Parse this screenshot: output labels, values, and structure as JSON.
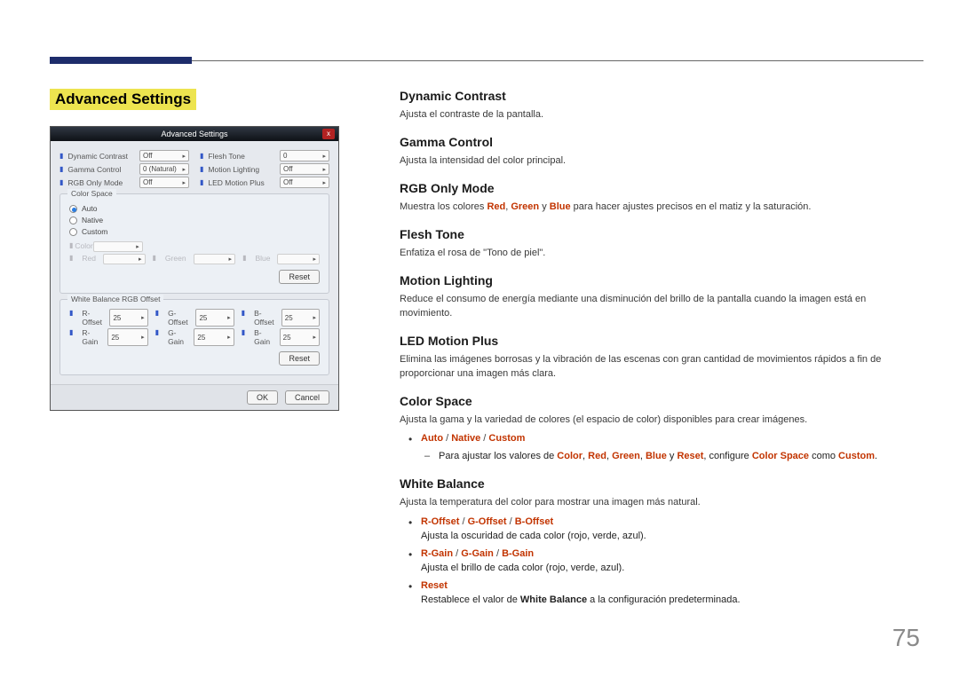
{
  "page_number": "75",
  "heading": "Advanced Settings",
  "dialog": {
    "title": "Advanced Settings",
    "rows_left": [
      {
        "label": "Dynamic Contrast",
        "value": "Off"
      },
      {
        "label": "Gamma Control",
        "value": "0 (Natural)"
      },
      {
        "label": "RGB Only Mode",
        "value": "Off"
      }
    ],
    "rows_right": [
      {
        "label": "Flesh Tone",
        "value": "0"
      },
      {
        "label": "Motion Lighting",
        "value": "Off"
      },
      {
        "label": "LED Motion Plus",
        "value": "Off"
      }
    ],
    "color_space": {
      "legend": "Color Space",
      "radios": [
        {
          "label": "Auto",
          "checked": true
        },
        {
          "label": "Native",
          "checked": false
        },
        {
          "label": "Custom",
          "checked": false
        }
      ],
      "disabled_row": [
        {
          "label": "Color",
          "value": ""
        },
        {
          "label": "Red",
          "value": ""
        },
        {
          "label": "Green",
          "value": ""
        },
        {
          "label": "Blue",
          "value": ""
        }
      ],
      "reset": "Reset"
    },
    "wb": {
      "legend": "White Balance RGB Offset",
      "rows": [
        [
          {
            "label": "R-Offset",
            "value": "25"
          },
          {
            "label": "G-Offset",
            "value": "25"
          },
          {
            "label": "B-Offset",
            "value": "25"
          }
        ],
        [
          {
            "label": "R-Gain",
            "value": "25"
          },
          {
            "label": "G-Gain",
            "value": "25"
          },
          {
            "label": "B-Gain",
            "value": "25"
          }
        ]
      ],
      "reset": "Reset"
    },
    "ok": "OK",
    "cancel": "Cancel"
  },
  "sections": {
    "dynamic_contrast": {
      "h": "Dynamic Contrast",
      "t": "Ajusta el contraste de la pantalla."
    },
    "gamma_control": {
      "h": "Gamma Control",
      "t": "Ajusta la intensidad del color principal."
    },
    "rgb_only": {
      "h": "RGB Only Mode",
      "pre": "Muestra los colores ",
      "red": "Red",
      "green": "Green",
      "blue": "Blue",
      "post": " para hacer ajustes precisos en el matiz y la saturación.",
      "comma": ", ",
      "y": " y "
    },
    "flesh_tone": {
      "h": "Flesh Tone",
      "t": "Enfatiza el rosa de \"Tono de piel\"."
    },
    "motion_lighting": {
      "h": "Motion Lighting",
      "t": "Reduce el consumo de energía mediante una disminución del brillo de la pantalla cuando la imagen está en movimiento."
    },
    "led_motion_plus": {
      "h": "LED Motion Plus",
      "t": "Elimina las imágenes borrosas y la vibración de las escenas con gran cantidad de movimientos rápidos a fin de proporcionar una imagen más clara."
    },
    "color_space": {
      "h": "Color Space",
      "t": "Ajusta la gama y la variedad de colores (el espacio de color) disponibles para crear imágenes.",
      "opts": {
        "auto": "Auto",
        "native": "Native",
        "custom": "Custom",
        "sep": " / "
      },
      "dash_pre": "Para ajustar los valores de ",
      "c_color": "Color",
      "c_red": "Red",
      "c_green": "Green",
      "c_blue": "Blue",
      "c_reset": "Reset",
      "conf": ", configure ",
      "cs": "Color Space",
      "como": " como ",
      "comma": ", ",
      "y": " y ",
      "dot": "."
    },
    "white_balance": {
      "h": "White Balance",
      "t": "Ajusta la temperatura del color para mostrar una imagen más natural.",
      "b1": {
        "r": "R-Offset",
        "g": "G-Offset",
        "b": "B-Offset",
        "sep": " / ",
        "desc": "Ajusta la oscuridad de cada color (rojo, verde, azul)."
      },
      "b2": {
        "r": "R-Gain",
        "g": "G-Gain",
        "b": "B-Gain",
        "sep": " / ",
        "desc": "Ajusta el brillo de cada color (rojo, verde, azul)."
      },
      "b3": {
        "reset": "Reset",
        "pre": "Restablece el valor de ",
        "wb": "White Balance",
        "post": " a la configuración predeterminada."
      }
    }
  }
}
